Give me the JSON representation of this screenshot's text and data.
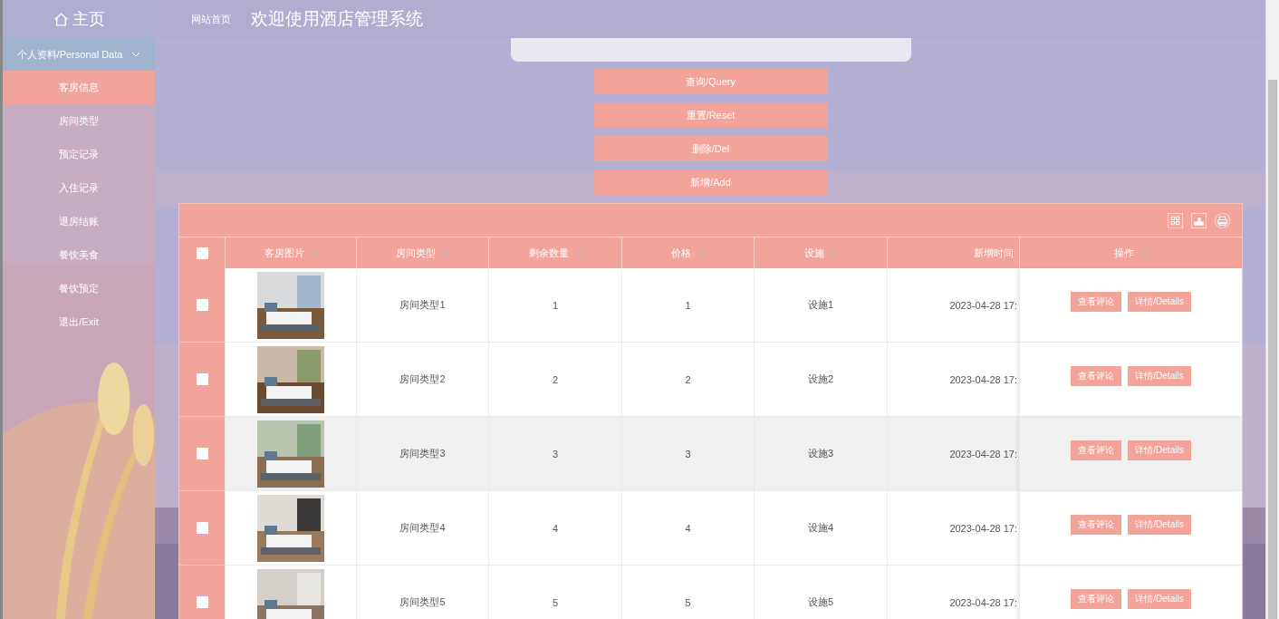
{
  "sidebar": {
    "title": "主页",
    "group": {
      "label": "个人资料/Personal Data",
      "expanded": true
    },
    "items": [
      {
        "label": "客房信息",
        "selected": true
      },
      {
        "label": "房间类型",
        "selected": false
      },
      {
        "label": "预定记录",
        "selected": false
      },
      {
        "label": "入住记录",
        "selected": false
      },
      {
        "label": "退房结账",
        "selected": false
      },
      {
        "label": "餐饮美食",
        "selected": false
      },
      {
        "label": "餐饮预定",
        "selected": false
      },
      {
        "label": "退出/Exit",
        "selected": false
      }
    ]
  },
  "header": {
    "breadcrumb": "网站首页",
    "title": "欢迎使用酒店管理系统"
  },
  "actions": [
    "查询/Query",
    "重置/Reset",
    "删除/Del",
    "新增/Add"
  ],
  "table": {
    "columns": [
      {
        "label": "客房图片",
        "sortable": true
      },
      {
        "label": "房间类型",
        "sortable": true
      },
      {
        "label": "剩余数量",
        "sortable": true
      },
      {
        "label": "价格",
        "sortable": true
      },
      {
        "label": "设施",
        "sortable": true
      },
      {
        "label": "新增时间",
        "sortable": false
      },
      {
        "label": "操作",
        "sortable": true
      }
    ],
    "rows": [
      {
        "checked": false,
        "highlighted": false,
        "type": "房间类型1",
        "count": "1",
        "price": "1",
        "facility": "设施1",
        "time": "2023-04-28 17:",
        "buttons": [
          "查看评论",
          "详情/Details"
        ]
      },
      {
        "checked": false,
        "highlighted": false,
        "type": "房间类型2",
        "count": "2",
        "price": "2",
        "facility": "设施2",
        "time": "2023-04-28 17:",
        "buttons": [
          "查看评论",
          "详情/Details"
        ]
      },
      {
        "checked": false,
        "highlighted": true,
        "type": "房间类型3",
        "count": "3",
        "price": "3",
        "facility": "设施3",
        "time": "2023-04-28 17:",
        "buttons": [
          "查看评论",
          "详情/Details"
        ]
      },
      {
        "checked": false,
        "highlighted": false,
        "type": "房间类型4",
        "count": "4",
        "price": "4",
        "facility": "设施4",
        "time": "2023-04-28 17:",
        "buttons": [
          "查看评论",
          "详情/Details"
        ]
      },
      {
        "checked": false,
        "highlighted": false,
        "type": "房间类型5",
        "count": "5",
        "price": "5",
        "facility": "设施5",
        "time": "2023-04-28 17:",
        "buttons": [
          "查看评论",
          "详情/Details"
        ]
      }
    ],
    "select_all": {
      "checked": false
    }
  }
}
